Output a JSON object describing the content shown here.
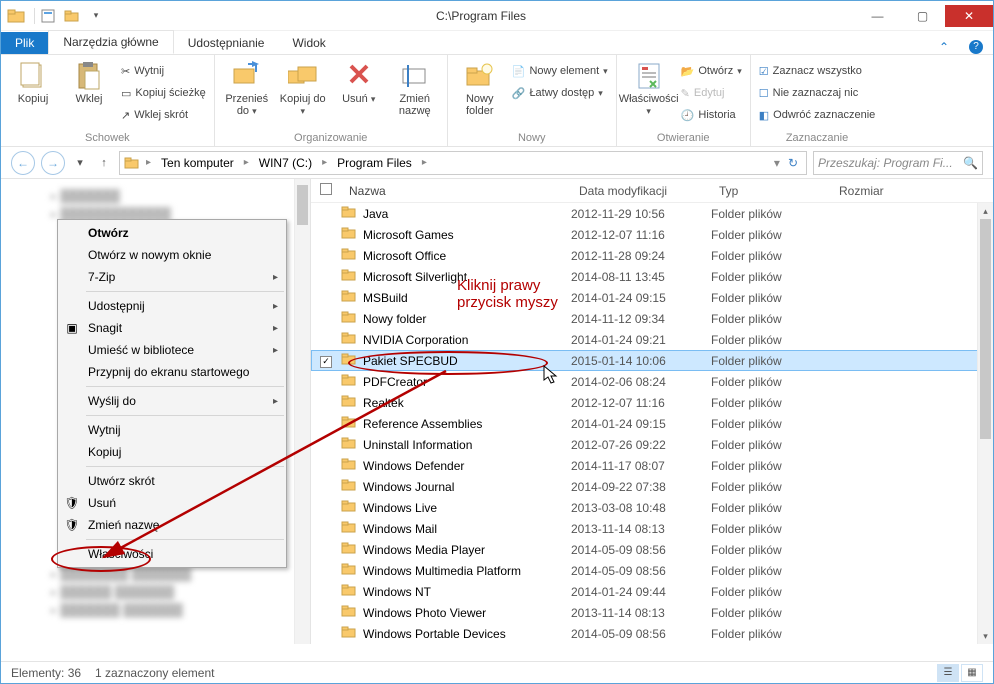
{
  "window": {
    "title": "C:\\Program Files"
  },
  "tabs": {
    "file": "Plik",
    "home": "Narzędzia główne",
    "share": "Udostępnianie",
    "view": "Widok"
  },
  "ribbon": {
    "clipboard": {
      "caption": "Schowek",
      "copy": "Kopiuj",
      "paste": "Wklej",
      "cut": "Wytnij",
      "copypath": "Kopiuj ścieżkę",
      "pasteshortcut": "Wklej skrót"
    },
    "organize": {
      "caption": "Organizowanie",
      "moveto": "Przenieś do",
      "copyto": "Kopiuj do",
      "delete": "Usuń",
      "rename": "Zmień nazwę"
    },
    "new": {
      "caption": "Nowy",
      "newfolder": "Nowy folder",
      "newitem": "Nowy element",
      "easyaccess": "Łatwy dostęp"
    },
    "open": {
      "caption": "Otwieranie",
      "properties": "Właściwości",
      "open": "Otwórz",
      "edit": "Edytuj",
      "history": "Historia"
    },
    "select": {
      "caption": "Zaznaczanie",
      "selectall": "Zaznacz wszystko",
      "selectnone": "Nie zaznaczaj nic",
      "invert": "Odwróć zaznaczenie"
    }
  },
  "address": {
    "crumbs": [
      "Ten komputer",
      "WIN7 (C:)",
      "Program Files"
    ],
    "refresh": "↻",
    "search_placeholder": "Przeszukaj: Program Fi..."
  },
  "columns": {
    "name": "Nazwa",
    "date": "Data modyfikacji",
    "type": "Typ",
    "size": "Rozmiar"
  },
  "folders": [
    {
      "name": "Java",
      "date": "2012-11-29 10:56",
      "type": "Folder plików"
    },
    {
      "name": "Microsoft Games",
      "date": "2012-12-07 11:16",
      "type": "Folder plików"
    },
    {
      "name": "Microsoft Office",
      "date": "2012-11-28 09:24",
      "type": "Folder plików"
    },
    {
      "name": "Microsoft Silverlight",
      "date": "2014-08-11 13:45",
      "type": "Folder plików"
    },
    {
      "name": "MSBuild",
      "date": "2014-01-24 09:15",
      "type": "Folder plików"
    },
    {
      "name": "Nowy folder",
      "date": "2014-11-12 09:34",
      "type": "Folder plików"
    },
    {
      "name": "NVIDIA Corporation",
      "date": "2014-01-24 09:21",
      "type": "Folder plików"
    },
    {
      "name": "Pakiet SPECBUD",
      "date": "2015-01-14 10:06",
      "type": "Folder plików",
      "selected": true
    },
    {
      "name": "PDFCreator",
      "date": "2014-02-06 08:24",
      "type": "Folder plików"
    },
    {
      "name": "Realtek",
      "date": "2012-12-07 11:16",
      "type": "Folder plików"
    },
    {
      "name": "Reference Assemblies",
      "date": "2014-01-24 09:15",
      "type": "Folder plików"
    },
    {
      "name": "Uninstall Information",
      "date": "2012-07-26 09:22",
      "type": "Folder plików"
    },
    {
      "name": "Windows Defender",
      "date": "2014-11-17 08:07",
      "type": "Folder plików"
    },
    {
      "name": "Windows Journal",
      "date": "2014-09-22 07:38",
      "type": "Folder plików"
    },
    {
      "name": "Windows Live",
      "date": "2013-03-08 10:48",
      "type": "Folder plików"
    },
    {
      "name": "Windows Mail",
      "date": "2013-11-14 08:13",
      "type": "Folder plików"
    },
    {
      "name": "Windows Media Player",
      "date": "2014-05-09 08:56",
      "type": "Folder plików"
    },
    {
      "name": "Windows Multimedia Platform",
      "date": "2014-05-09 08:56",
      "type": "Folder plików"
    },
    {
      "name": "Windows NT",
      "date": "2014-01-24 09:44",
      "type": "Folder plików"
    },
    {
      "name": "Windows Photo Viewer",
      "date": "2013-11-14 08:13",
      "type": "Folder plików"
    },
    {
      "name": "Windows Portable Devices",
      "date": "2014-05-09 08:56",
      "type": "Folder plików"
    }
  ],
  "context_menu": {
    "open": "Otwórz",
    "open_new": "Otwórz w nowym oknie",
    "7zip": "7-Zip",
    "share": "Udostępnij",
    "snagit": "Snagit",
    "include": "Umieść w bibliotece",
    "pin": "Przypnij do ekranu startowego",
    "sendto": "Wyślij do",
    "cut": "Wytnij",
    "copy": "Kopiuj",
    "shortcut": "Utwórz skrót",
    "delete": "Usuń",
    "rename": "Zmień nazwę",
    "properties": "Właściwości"
  },
  "status": {
    "count_label": "Elementy: 36",
    "selection_label": "1 zaznaczony element"
  },
  "annotation": {
    "line1": "Kliknij prawy",
    "line2": "przycisk myszy"
  }
}
